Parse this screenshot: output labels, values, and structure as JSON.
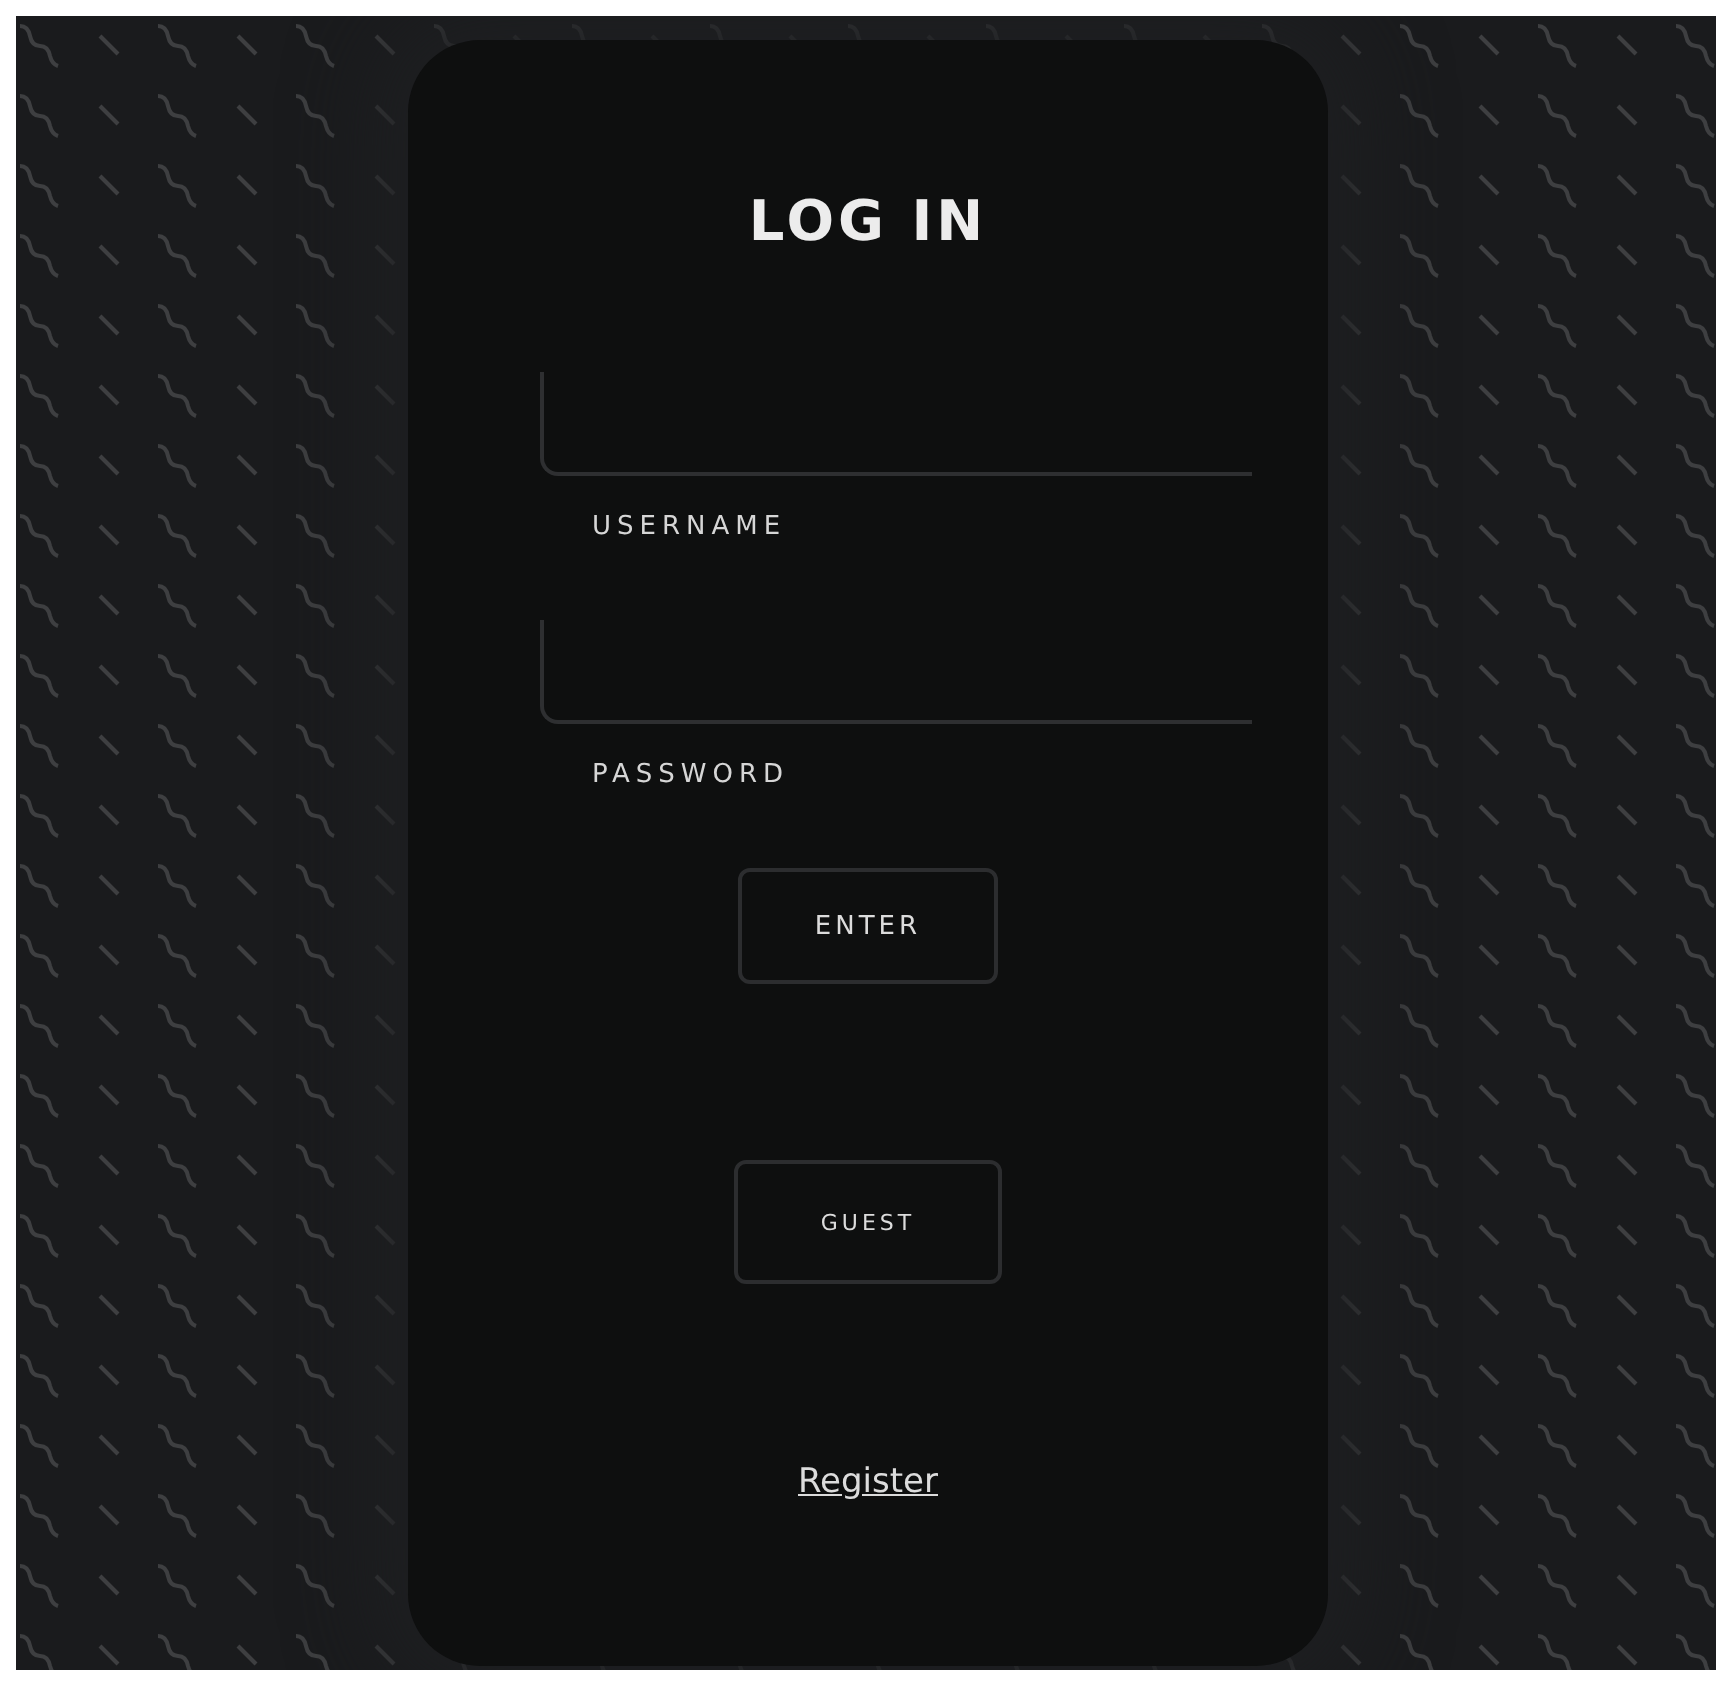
{
  "title": "LOG IN",
  "fields": [
    {
      "label": "USERNAME"
    },
    {
      "label": "PASSWORD"
    }
  ],
  "buttons": [
    "ENTER",
    "GUEST"
  ],
  "link": "Register"
}
